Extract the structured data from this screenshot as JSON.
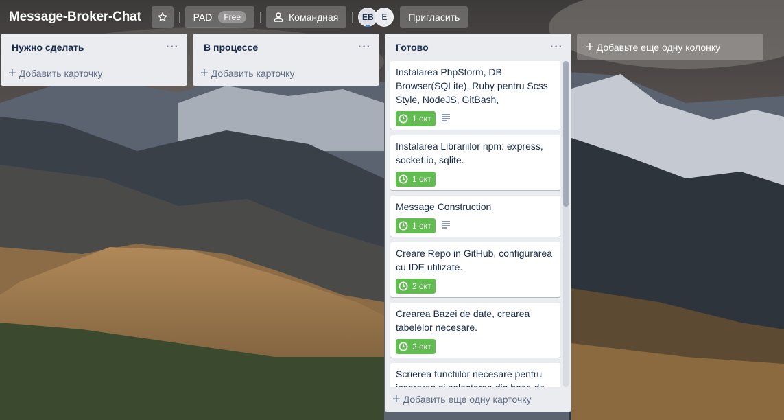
{
  "header": {
    "board_title": "Message-Broker-Chat",
    "workspace_label": "PAD",
    "workspace_badge": "Free",
    "team_label": "Командная",
    "members": [
      "EB",
      "E"
    ],
    "invite_label": "Пригласить"
  },
  "lists": [
    {
      "title": "Нужно сделать",
      "menu": "···",
      "add_card": "Добавить карточку",
      "cards": []
    },
    {
      "title": "В процессе",
      "menu": "···",
      "add_card": "Добавить карточку",
      "cards": []
    },
    {
      "title": "Готово",
      "menu": "···",
      "add_card": "Добавить еще одну карточку",
      "cards": [
        {
          "text": "Instalarea PhpStorm, DB Browser(SQLite), Ruby pentru Scss Style, NodeJS, GitBash,",
          "due": "1 окт",
          "has_description": true
        },
        {
          "text": "Instalarea Librariilor npm: express, socket.io, sqlite.",
          "due": "1 окт",
          "has_description": false
        },
        {
          "text": "Message Construction",
          "due": "1 окт",
          "has_description": true
        },
        {
          "text": "Creare Repo in GitHub, configurarea cu IDE utilizate.",
          "due": "2 окт",
          "has_description": false
        },
        {
          "text": "Crearea Bazei de date, crearea tabelelor necesare.",
          "due": "2 окт",
          "has_description": false
        },
        {
          "text": "Scrierea functiilor necesare pentru inserarea si selectarea din baza de date",
          "due": "",
          "has_description": false
        }
      ]
    }
  ],
  "add_list": "Добавьте еще одну колонку",
  "colors": {
    "due_badge": "#61bd4f",
    "list_bg": "#ebecf0",
    "text": "#172b4d"
  }
}
